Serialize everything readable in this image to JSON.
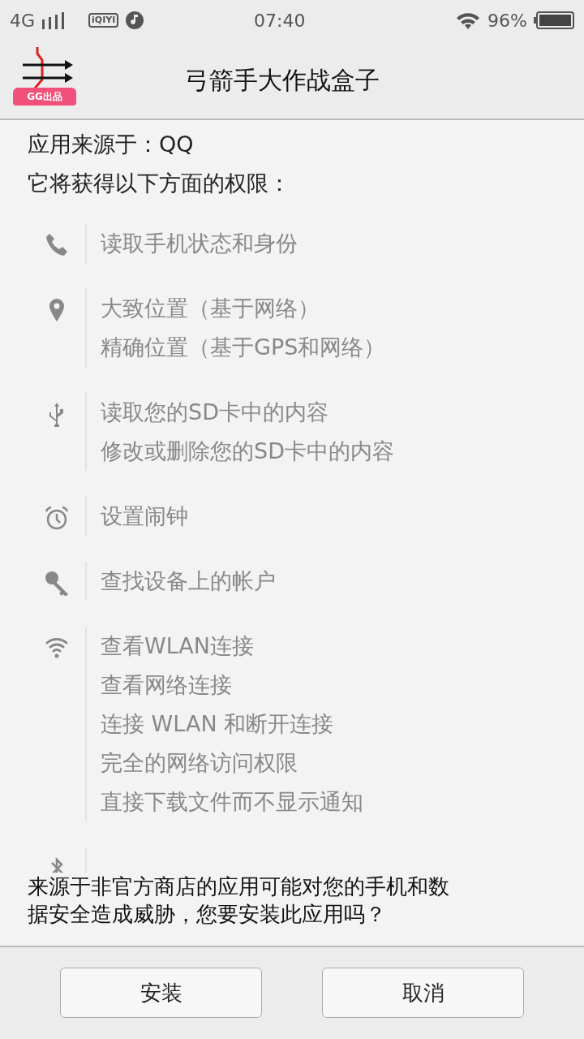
{
  "status_bar": {
    "network": "4G",
    "app_logo": "iQIYI",
    "time": "07:40",
    "battery": "96%"
  },
  "header": {
    "app_badge": "GG出品",
    "title": "弓箭手大作战盒子"
  },
  "source": "应用来源于：QQ",
  "permissions_heading": "它将获得以下方面的权限：",
  "permission_groups": [
    {
      "kind": "phone",
      "items": [
        "读取手机状态和身份"
      ]
    },
    {
      "kind": "location",
      "items": [
        "大致位置（基于网络）",
        "精确位置（基于GPS和网络）"
      ]
    },
    {
      "kind": "usb",
      "items": [
        "读取您的SD卡中的内容",
        "修改或删除您的SD卡中的内容"
      ]
    },
    {
      "kind": "alarm",
      "items": [
        "设置闹钟"
      ]
    },
    {
      "kind": "key",
      "items": [
        "查找设备上的帐户"
      ]
    },
    {
      "kind": "wifi",
      "items": [
        "查看WLAN连接",
        "查看网络连接",
        "连接 WLAN 和断开连接",
        "完全的网络访问权限",
        "直接下载文件而不显示通知"
      ]
    },
    {
      "kind": "bluetooth"
    }
  ],
  "warning": "来源于非官方商店的应用可能对您的手机和数据安全造成威胁，您要安装此应用吗？",
  "buttons": [
    "安装",
    "取消"
  ]
}
